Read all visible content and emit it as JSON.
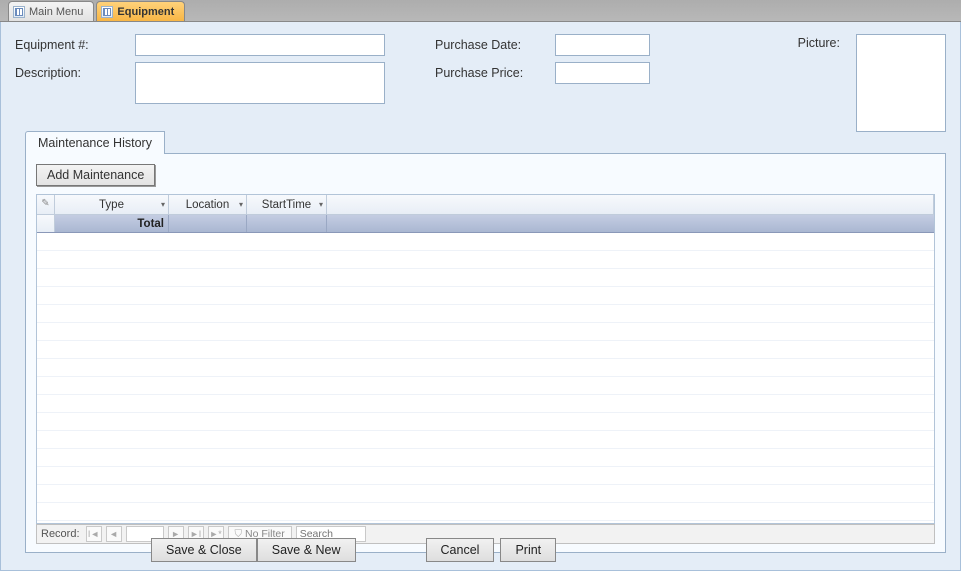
{
  "tabs": {
    "inactive": "Main Menu",
    "active": "Equipment"
  },
  "fields": {
    "equipment_label": "Equipment #:",
    "equipment_value": "",
    "description_label": "Description:",
    "description_value": "",
    "purchase_date_label": "Purchase Date:",
    "purchase_date_value": "",
    "purchase_price_label": "Purchase Price:",
    "purchase_price_value": "",
    "picture_label": "Picture:"
  },
  "subform": {
    "tab_label": "Maintenance History",
    "add_button": "Add Maintenance",
    "columns": {
      "type": "Type",
      "location": "Location",
      "starttime": "StartTime"
    },
    "total_label": "Total"
  },
  "recordnav": {
    "label": "Record:",
    "first": "І◄",
    "prev": "◄",
    "next": "►",
    "last": "►І",
    "new": "►*",
    "filter_label": "No Filter",
    "search_placeholder": "Search"
  },
  "buttons": {
    "save_close": "Save & Close",
    "save_new": "Save & New",
    "cancel": "Cancel",
    "print": "Print"
  }
}
